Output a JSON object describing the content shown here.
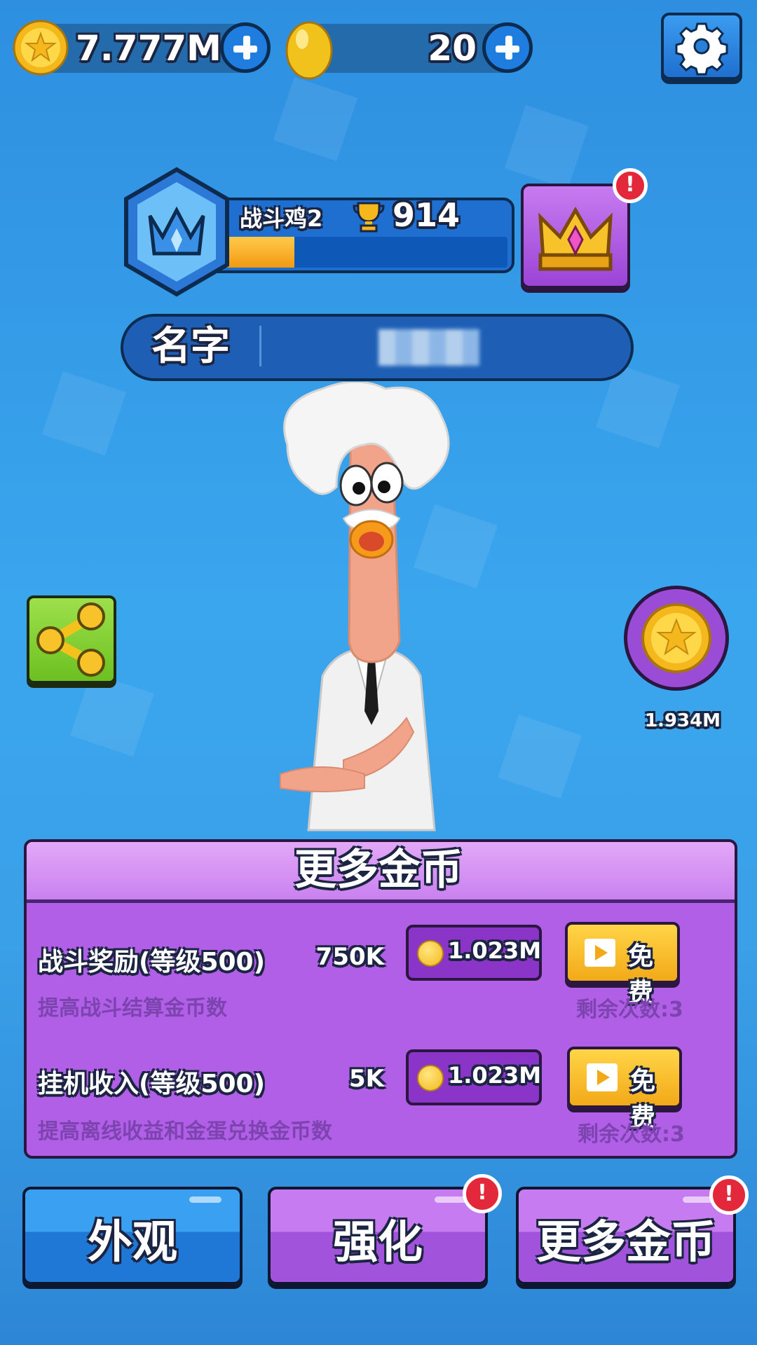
{
  "currency": {
    "coins": "7.777M",
    "eggs": "20"
  },
  "rank": {
    "name": "战斗鸡2",
    "trophies": "914",
    "progress": 0.25
  },
  "player": {
    "name_label": "名字"
  },
  "collect": {
    "value": "1.934M"
  },
  "panel": {
    "title": "更多金币",
    "rows": [
      {
        "title": "战斗奖励(等级500)",
        "amount": "750K",
        "description": "提高战斗结算金币数",
        "upgrade_cost": "1.023M",
        "free_label": "免费",
        "remaining": "剩余次数:3"
      },
      {
        "title": "挂机收入(等级500)",
        "amount": "5K",
        "description": "提高离线收益和金蛋兑换金币数",
        "upgrade_cost": "1.023M",
        "free_label": "免费",
        "remaining": "剩余次数:3"
      }
    ]
  },
  "tabs": [
    {
      "label": "外观"
    },
    {
      "label": "强化"
    },
    {
      "label": "更多金币"
    }
  ],
  "alerts": {
    "glyph": "!"
  },
  "colors": {
    "background": "#3aa6ee",
    "panel_purple": "#b05fe6",
    "gold": "#f4b81c",
    "alert_red": "#e3283b"
  }
}
